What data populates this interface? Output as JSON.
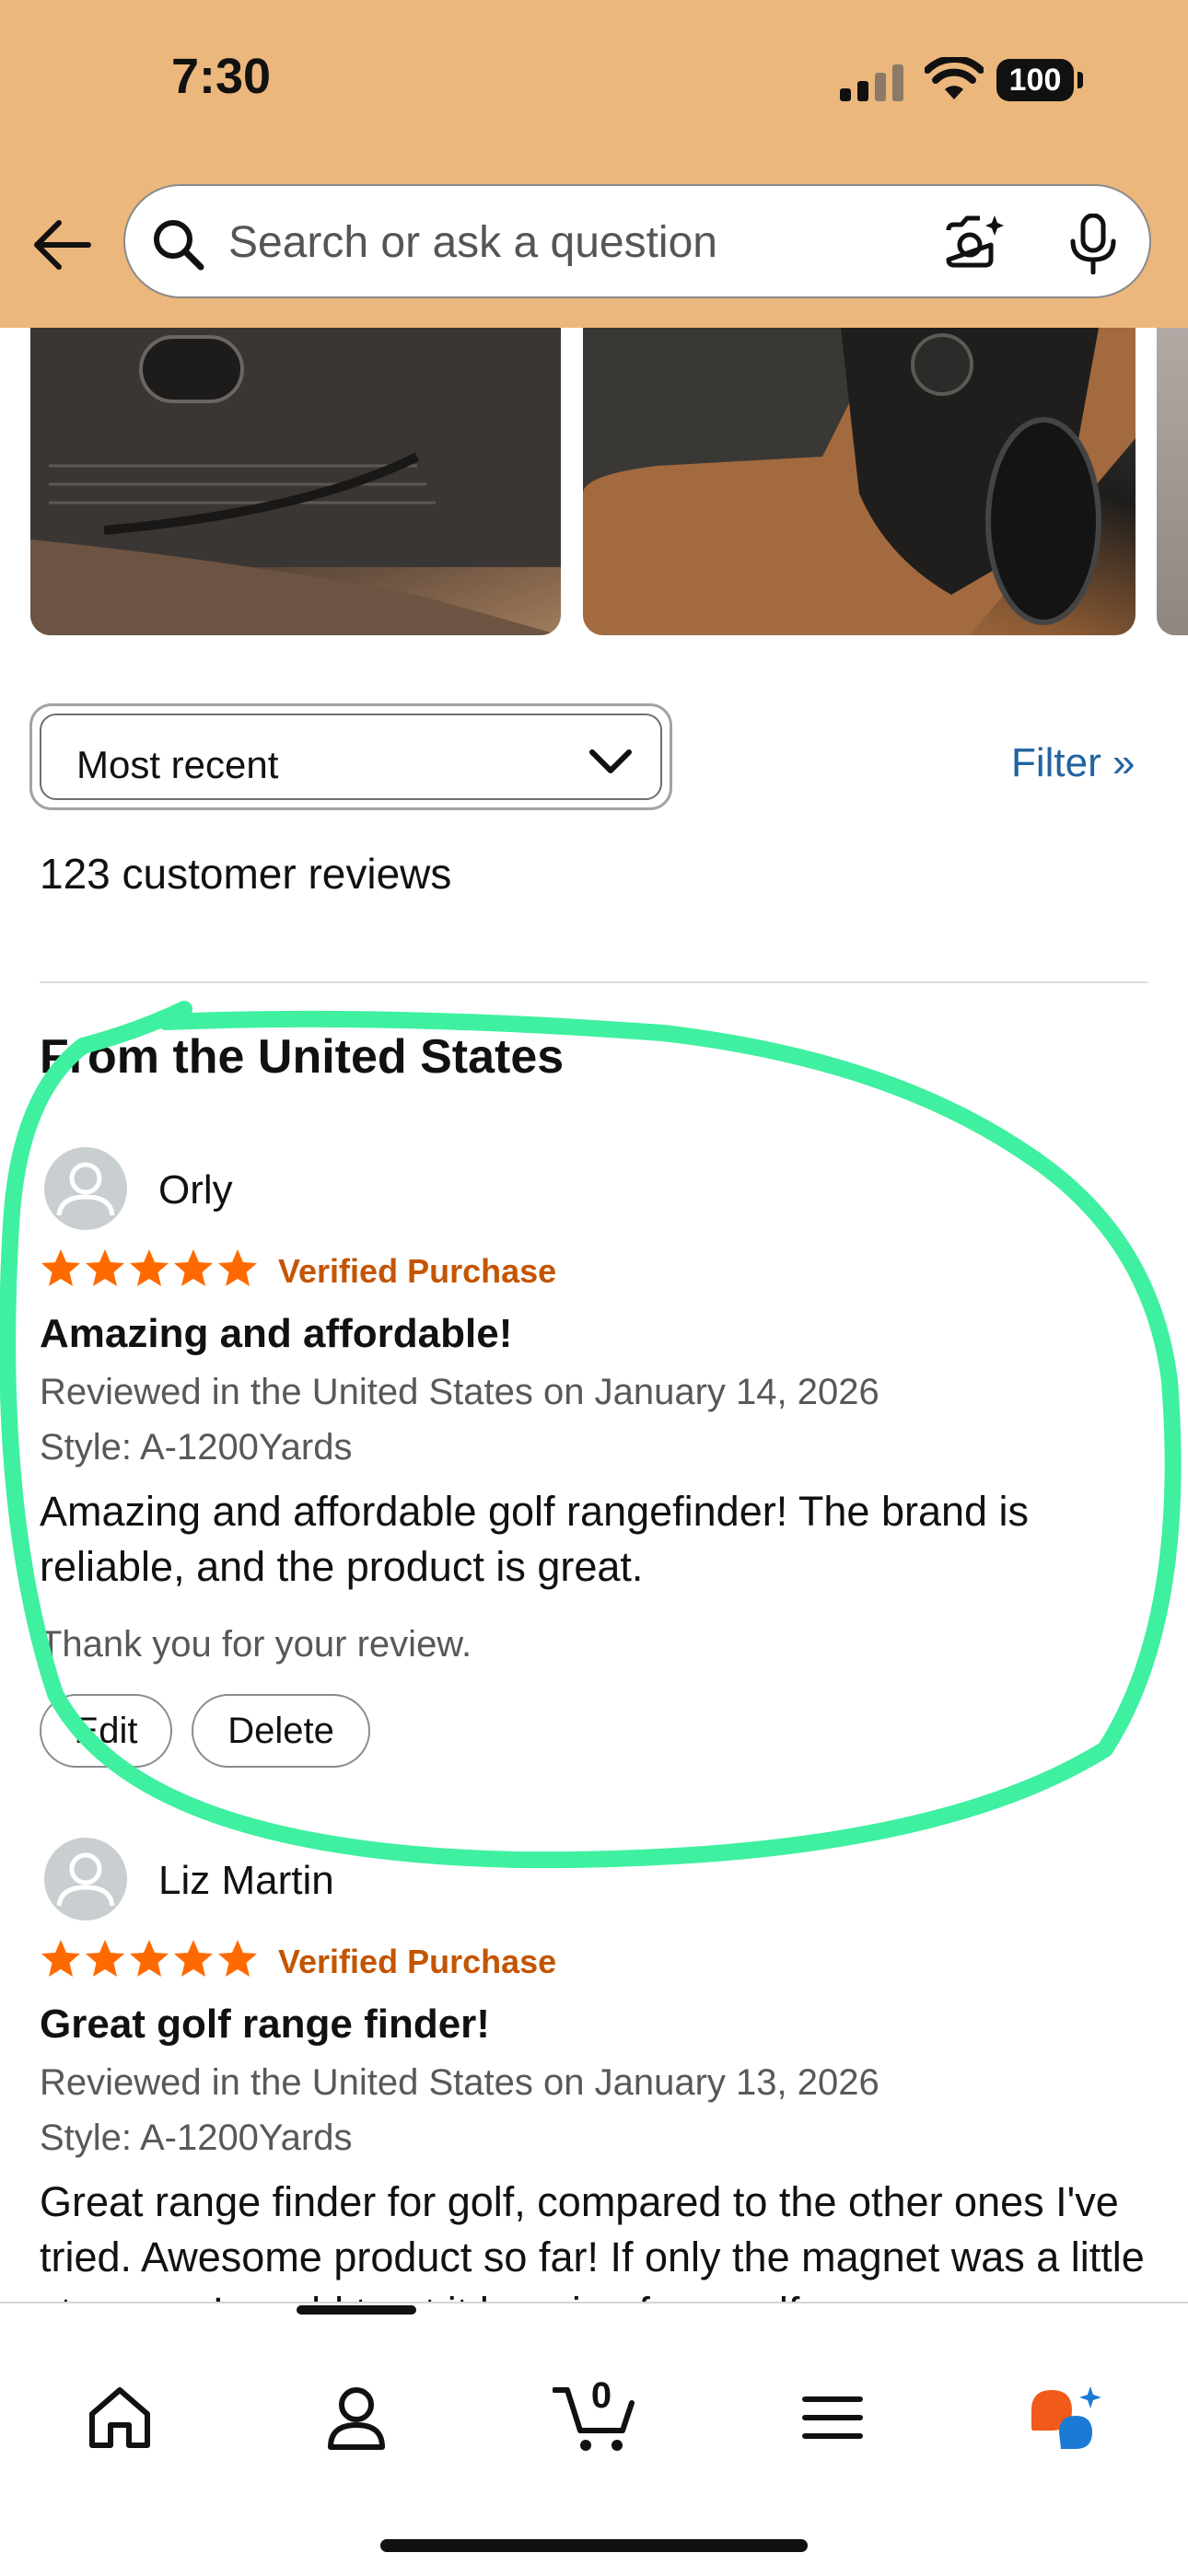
{
  "status_bar": {
    "time": "7:30",
    "battery": "100",
    "icons": [
      "signal-icon",
      "wifi-icon",
      "battery-icon"
    ]
  },
  "header": {
    "search_placeholder": "Search or ask a question",
    "icons": [
      "back-arrow-icon",
      "search-icon",
      "camera-icon",
      "mic-icon"
    ]
  },
  "sort": {
    "selected": "Most recent"
  },
  "filter_label": "Filter »",
  "review_count": "123 customer reviews",
  "section_title": "From the United States",
  "reviews": [
    {
      "name": "Orly",
      "rating": 5,
      "verified": "Verified Purchase",
      "title": "Amazing and affordable!",
      "date": "Reviewed in the United States on January 14, 2026",
      "style": "Style: A-1200Yards",
      "body": "Amazing and affordable golf rangefinder! The brand is reliable, and the product is great.",
      "thanks": "Thank you for your review.",
      "edit_label": "Edit",
      "delete_label": "Delete"
    },
    {
      "name": "Liz Martin",
      "rating": 5,
      "verified": "Verified Purchase",
      "title": "Great golf range finder!",
      "date": "Reviewed in the United States on January 13, 2026",
      "style": "Style: A-1200Yards",
      "body": "Great range finder for golf, compared to the other ones I've tried. Awesome product so far! If only the magnet was a little stronger, I would trust it hanging from golf"
    }
  ],
  "tabbar": {
    "cart_count": "0",
    "items": [
      "home-icon",
      "profile-icon",
      "cart-icon",
      "menu-icon",
      "rufus-icon"
    ]
  },
  "colors": {
    "header_bg": "#ecb77c",
    "star": "#ff6a00",
    "verified": "#c45500",
    "link": "#2162a1",
    "highlight": "#3ef0a0"
  }
}
